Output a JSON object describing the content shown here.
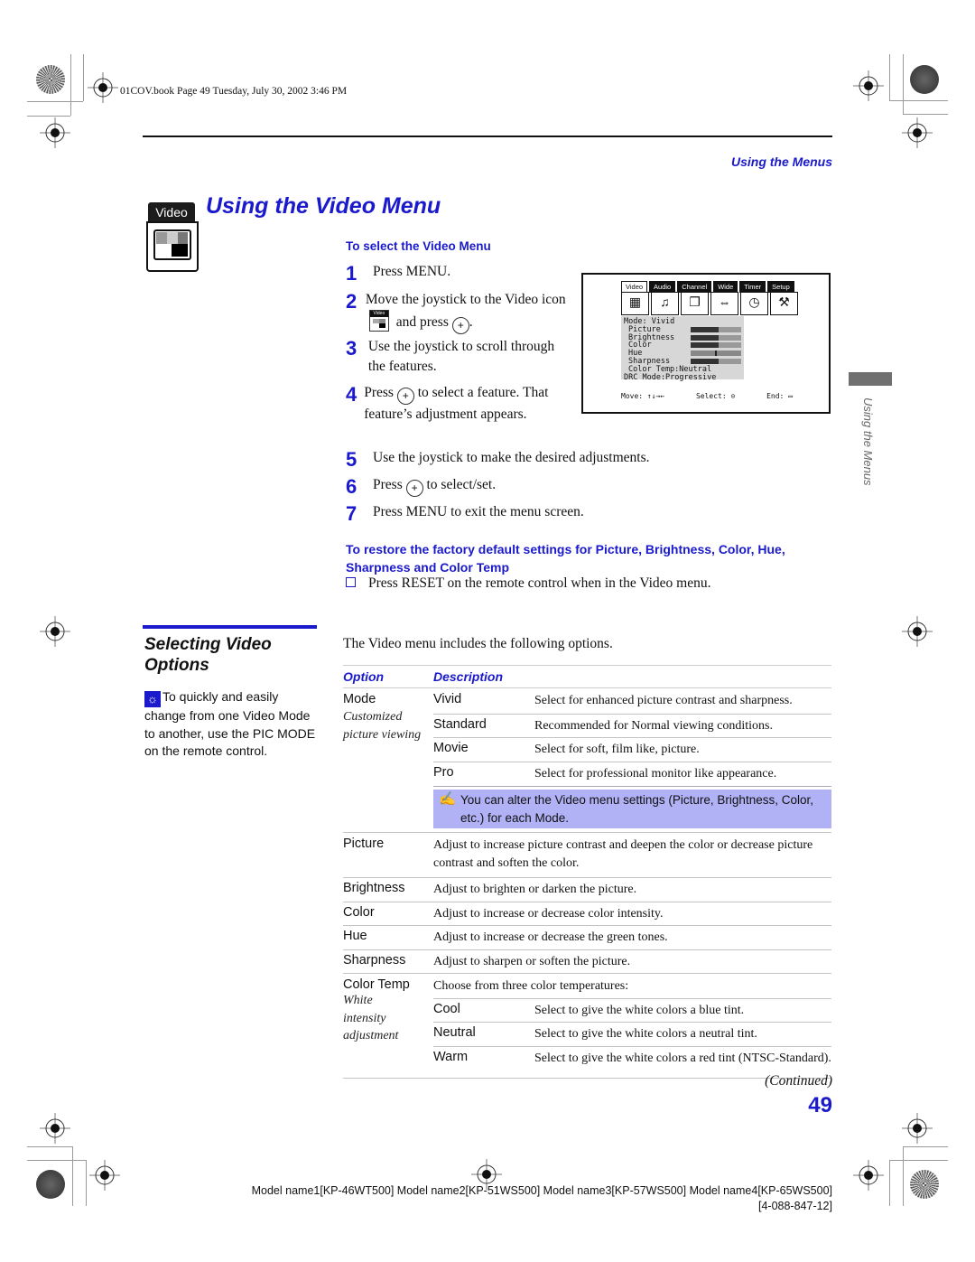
{
  "book_line": "01COV.book  Page 49  Tuesday, July 30, 2002  3:46 PM",
  "running_header": "Using the Menus",
  "title": "Using the Video Menu",
  "video_icon_label": "Video",
  "select_section": {
    "heading": "To select the Video Menu",
    "steps": [
      {
        "num": "1",
        "text": "Press MENU."
      },
      {
        "num": "2",
        "text_before": "Move the joystick to the Video icon",
        "text_after": "and press",
        "icon_label": "Video"
      },
      {
        "num": "3",
        "text": "Use the joystick to scroll through the features."
      },
      {
        "num": "4",
        "text_before": "Press",
        "text_after": "to select a feature. That feature’s adjustment appears."
      },
      {
        "num": "5",
        "text": "Use the joystick to make the desired adjustments."
      },
      {
        "num": "6",
        "text_before": "Press",
        "text_after": "to select/set."
      },
      {
        "num": "7",
        "text": "Press MENU to exit the menu screen."
      }
    ]
  },
  "tv_menu": {
    "tabs": [
      "Video",
      "Audio",
      "Channel",
      "Wide",
      "Timer",
      "Setup"
    ],
    "active_tab": "Video",
    "mode_line": "Mode: Vivid",
    "items": [
      {
        "label": "Picture",
        "level": 0.55
      },
      {
        "label": "Brightness",
        "level": 0.55
      },
      {
        "label": "Color",
        "level": 0.55
      },
      {
        "label": "Hue",
        "level": 0.5
      },
      {
        "label": "Sharpness",
        "level": 0.55
      }
    ],
    "color_temp_line": "Color  Temp:Neutral",
    "drc_line": "DRC Mode:Progressive",
    "footer_move": "Move: ↑↓→←",
    "footer_select": "Select: ⊙",
    "footer_end": "End: ▭"
  },
  "side_tab_label": "Using the Menus",
  "restore_section": {
    "heading": "To restore the factory default settings for Picture, Brightness, Color, Hue, Sharpness and Color Temp",
    "bullet": "Press RESET on the remote control when in the Video menu."
  },
  "options_section": {
    "title_line1": "Selecting Video",
    "title_line2": "Options",
    "tip": "To quickly and easily change from one Video Mode to another, use the PIC MODE on the remote control.",
    "intro": "The Video menu includes the following options.",
    "table": {
      "headers": [
        "Option",
        "Description"
      ],
      "mode": {
        "name": "Mode",
        "note": "Customized picture viewing",
        "sub": [
          {
            "name": "Vivid",
            "desc": "Select for enhanced picture contrast and sharpness."
          },
          {
            "name": "Standard",
            "desc": "Recommended for Normal viewing conditions."
          },
          {
            "name": "Movie",
            "desc": "Select for soft, film like, picture."
          },
          {
            "name": "Pro",
            "desc": "Select for professional monitor like appearance."
          }
        ],
        "note_box": "You can alter the Video menu settings (Picture, Brightness, Color, etc.) for each Mode."
      },
      "simple_rows": [
        {
          "name": "Picture",
          "desc": "Adjust to increase picture contrast and deepen the color or decrease picture contrast and soften the color."
        },
        {
          "name": "Brightness",
          "desc": "Adjust to brighten or darken the picture."
        },
        {
          "name": "Color",
          "desc": "Adjust to increase or decrease color intensity."
        },
        {
          "name": "Hue",
          "desc": "Adjust to increase or decrease the green tones."
        },
        {
          "name": "Sharpness",
          "desc": "Adjust to sharpen or soften the picture."
        }
      ],
      "color_temp": {
        "name": "Color Temp",
        "note": "White intensity adjustment",
        "intro": "Choose from three color temperatures:",
        "sub": [
          {
            "name": "Cool",
            "desc": "Select to give the white colors a blue tint."
          },
          {
            "name": "Neutral",
            "desc": "Select to give the white colors a neutral tint."
          },
          {
            "name": "Warm",
            "desc": "Select to give the white colors a red tint (NTSC-Standard)."
          }
        ]
      }
    }
  },
  "continued": "(Continued)",
  "page_number": "49",
  "model_line": "Model name1[KP-46WT500] Model name2[KP-51WS500] Model name3[KP-57WS500] Model name4[KP-65WS500]",
  "part_number": "[4-088-847-12]",
  "colors": {
    "accent_blue": "#1a1acc",
    "note_bg": "#b1b1f5"
  }
}
